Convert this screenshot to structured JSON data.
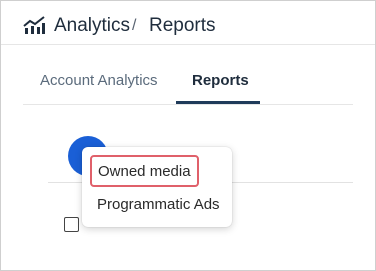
{
  "header": {
    "icon": "analytics-chart-icon",
    "title": "Analytics",
    "separator": "/",
    "current": "Reports"
  },
  "tabs": [
    {
      "label": "Account Analytics",
      "active": false
    },
    {
      "label": "Reports",
      "active": true
    }
  ],
  "fab": {
    "icon": "add-button-icon"
  },
  "row": {
    "text": ""
  },
  "menu": {
    "items": [
      {
        "label": "Owned media",
        "highlighted": true
      },
      {
        "label": "Programmatic Ads",
        "highlighted": false
      }
    ]
  },
  "colors": {
    "accent": "#1a5fd6",
    "tab_underline": "#1f3b5a",
    "highlight_border": "#e0606a"
  }
}
